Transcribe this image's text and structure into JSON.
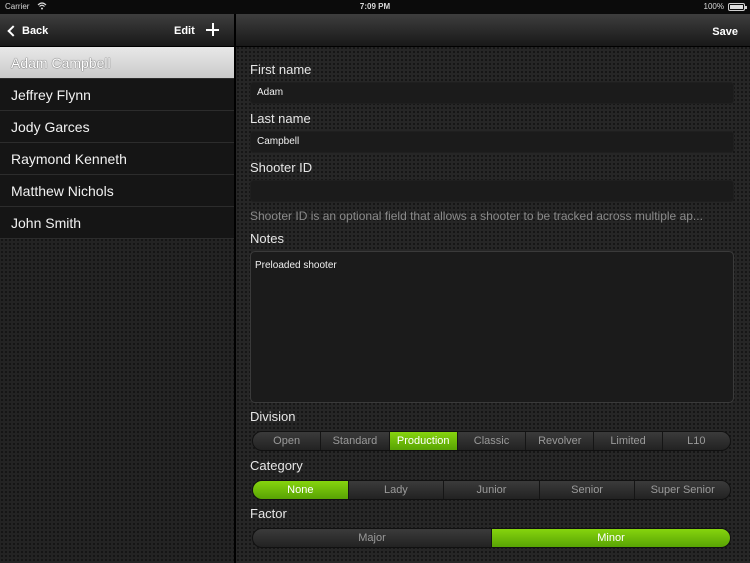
{
  "status_bar": {
    "carrier": "Carrier",
    "time": "7:09 PM",
    "battery": "100%"
  },
  "left_nav": {
    "back_label": "Back",
    "edit_label": "Edit"
  },
  "shooters": [
    {
      "name": "Adam Campbell",
      "selected": true
    },
    {
      "name": "Jeffrey Flynn",
      "selected": false
    },
    {
      "name": "Jody Garces",
      "selected": false
    },
    {
      "name": "Raymond Kenneth",
      "selected": false
    },
    {
      "name": "Matthew Nichols",
      "selected": false
    },
    {
      "name": "John Smith",
      "selected": false
    }
  ],
  "right_nav": {
    "save_label": "Save"
  },
  "form": {
    "first_name_label": "First name",
    "first_name_value": "Adam",
    "last_name_label": "Last name",
    "last_name_value": "Campbell",
    "shooter_id_label": "Shooter ID",
    "shooter_id_value": "",
    "shooter_id_help": "Shooter ID is an optional field that allows a shooter to be tracked across multiple ap...",
    "notes_label": "Notes",
    "notes_value": "Preloaded shooter",
    "division_label": "Division",
    "divisions": [
      "Open",
      "Standard",
      "Production",
      "Classic",
      "Revolver",
      "Limited",
      "L10"
    ],
    "division_selected": "Production",
    "category_label": "Category",
    "categories": [
      "None",
      "Lady",
      "Junior",
      "Senior",
      "Super Senior"
    ],
    "category_selected": "None",
    "factor_label": "Factor",
    "factors": [
      "Major",
      "Minor"
    ],
    "factor_selected": "Minor"
  },
  "colors": {
    "accent_green": "#6cbf08"
  },
  "icons": {
    "back": "chevron-left-icon",
    "add": "plus-icon",
    "wifi": "wifi-icon",
    "battery": "battery-icon"
  }
}
